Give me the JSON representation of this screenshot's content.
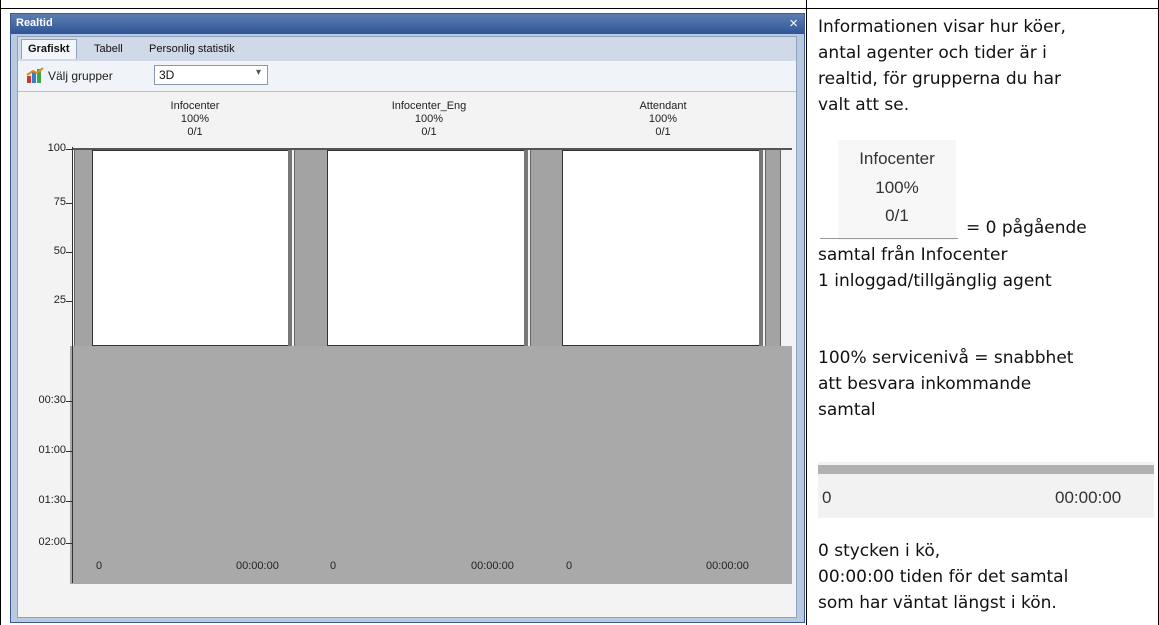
{
  "window": {
    "title": "Realtid",
    "close_glyph": "×"
  },
  "tabs": [
    {
      "label": "Grafiskt",
      "active": true
    },
    {
      "label": "Tabell",
      "active": false
    },
    {
      "label": "Personlig statistik",
      "active": false
    }
  ],
  "toolbar": {
    "icon": "chart-icon",
    "choose_groups_label": "Välj grupper",
    "view_select_value": "3D",
    "dropdown_arrow": "▾"
  },
  "chart": {
    "y_labels_top": [
      "100",
      "75",
      "50",
      "25"
    ],
    "y_labels_bottom": [
      "00:30",
      "01:00",
      "01:30",
      "02:00"
    ],
    "groups": [
      {
        "name": "Infocenter",
        "service_level": "100%",
        "calls_agents": "0/1",
        "queue_count": "0",
        "longest_wait": "00:00:00",
        "value_pct": 100
      },
      {
        "name": "Infocenter_Eng",
        "service_level": "100%",
        "calls_agents": "0/1",
        "queue_count": "0",
        "longest_wait": "00:00:00",
        "value_pct": 100
      },
      {
        "name": "Attendant",
        "service_level": "100%",
        "calls_agents": "0/1",
        "queue_count": "0",
        "longest_wait": "00:00:00",
        "value_pct": 100
      }
    ]
  },
  "explanation": {
    "intro": [
      "Informationen visar hur köer,",
      "antal agenter och tider är i",
      "realtid, för grupperna du har",
      "valt att se."
    ],
    "example_header": {
      "name": "Infocenter",
      "service_level": "100%",
      "calls_agents": "0/1"
    },
    "equals_text": "= 0 pågående",
    "lines_after": [
      "samtal från Infocenter",
      "1 inloggad/tillgänglig agent"
    ],
    "service_text": [
      "100% servicenivå = snabbhet",
      "att besvara inkommande",
      "samtal"
    ],
    "example_footer": {
      "queue_count": "0",
      "longest_wait": "00:00:00"
    },
    "footer_text": [
      "0 stycken i kö,",
      "00:00:00 tiden för det samtal",
      "som har väntat längst i kön."
    ]
  }
}
